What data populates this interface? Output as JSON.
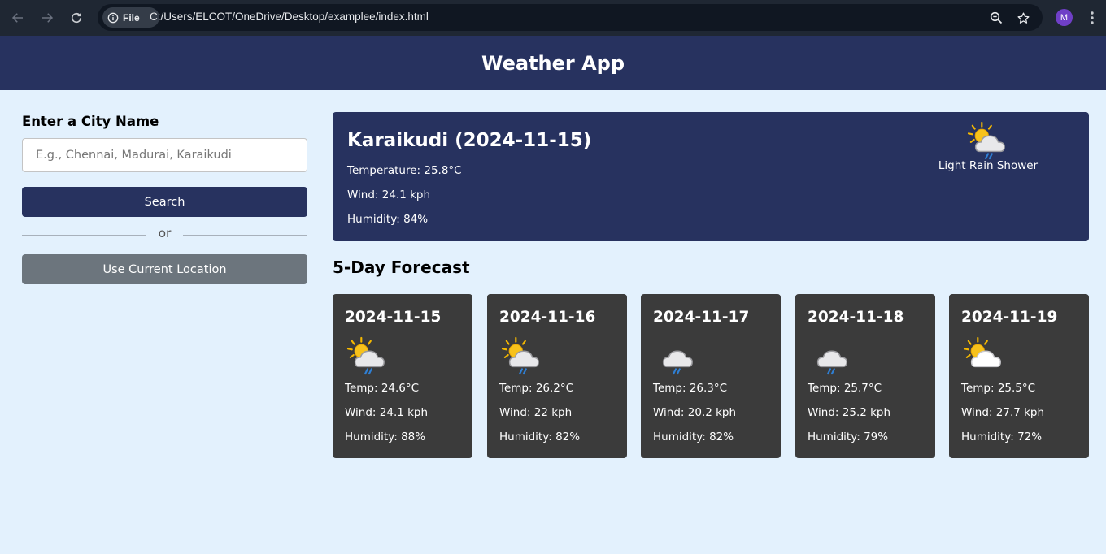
{
  "browser": {
    "file_chip": "File",
    "url": "C:/Users/ELCOT/OneDrive/Desktop/examplee/index.html",
    "avatar_letter": "M"
  },
  "header": {
    "title": "Weather App"
  },
  "search": {
    "label": "Enter a City Name",
    "placeholder": "E.g., Chennai, Madurai, Karaikudi",
    "search_button": "Search",
    "or_text": "or",
    "location_button": "Use Current Location"
  },
  "current": {
    "title": "Karaikudi (2024-11-15)",
    "temperature": "Temperature: 25.8°C",
    "wind": "Wind: 24.1 kph",
    "humidity": "Humidity: 84%",
    "condition": "Light Rain Shower",
    "icon": "sun-cloud-rain-icon"
  },
  "forecast": {
    "title": "5-Day Forecast",
    "days": [
      {
        "date": "2024-11-15",
        "icon": "sun-cloud-rain-icon",
        "temp": "Temp: 24.6°C",
        "wind": "Wind: 24.1 kph",
        "humidity": "Humidity: 88%"
      },
      {
        "date": "2024-11-16",
        "icon": "sun-cloud-rain-icon",
        "temp": "Temp: 26.2°C",
        "wind": "Wind: 22 kph",
        "humidity": "Humidity: 82%"
      },
      {
        "date": "2024-11-17",
        "icon": "cloud-rain-icon",
        "temp": "Temp: 26.3°C",
        "wind": "Wind: 20.2 kph",
        "humidity": "Humidity: 82%"
      },
      {
        "date": "2024-11-18",
        "icon": "cloud-rain-icon",
        "temp": "Temp: 25.7°C",
        "wind": "Wind: 25.2 kph",
        "humidity": "Humidity: 79%"
      },
      {
        "date": "2024-11-19",
        "icon": "sun-cloud-icon",
        "temp": "Temp: 25.5°C",
        "wind": "Wind: 27.7 kph",
        "humidity": "Humidity: 72%"
      }
    ]
  },
  "colors": {
    "header_bg": "#27325f",
    "page_bg": "#e3f1fd",
    "forecast_card_bg": "#3b3b3b",
    "secondary_button": "#6c757d"
  }
}
